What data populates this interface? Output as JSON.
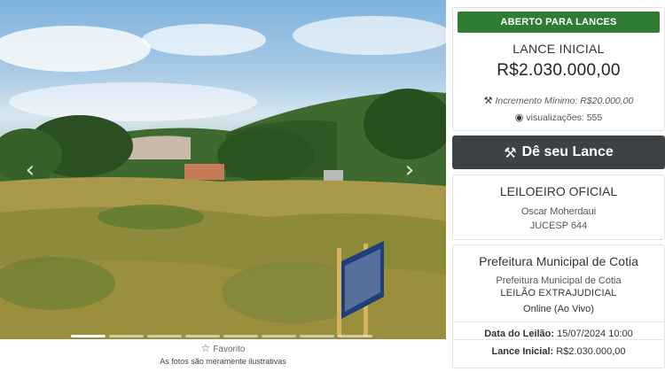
{
  "photo": {
    "favorite_label": "Favorito",
    "disclaimer": "As fotos são meramente ilustrativas",
    "slide_count": 8,
    "active_slide": 1
  },
  "status": {
    "badge": "ABERTO PARA LANCES",
    "color": "#2e7d32"
  },
  "bid": {
    "title": "LANCE INICIAL",
    "value": "R$2.030.000,00",
    "increment": "Incremento Mínimo: R$20.000,00",
    "views_label": "visualizações:",
    "views_count": "555"
  },
  "action": {
    "bid_button": "Dê seu Lance",
    "button_color": "#3d4247"
  },
  "auctioneer": {
    "title": "LEILOEIRO OFICIAL",
    "name": "Oscar Moherdaui",
    "registration": "JUCESP 644"
  },
  "details": {
    "seller_title": "Prefeitura Municipal de Cotia",
    "seller_name": "Prefeitura Municipal de Cotia",
    "auction_type": "LEILÃO EXTRAJUDICIAL",
    "mode": "Online (Ao Vivo)",
    "date_label": "Data do Leilão:",
    "date_value": "15/07/2024 10:00",
    "initial_label": "Lance Inicial:",
    "initial_value": "R$2.030.000,00"
  },
  "icons": {
    "prev": "chevron-left-icon",
    "next": "chevron-right-icon",
    "favorite": "star-icon",
    "increment": "gavel-icon",
    "views": "eye-icon",
    "bid": "gavel-icon"
  }
}
